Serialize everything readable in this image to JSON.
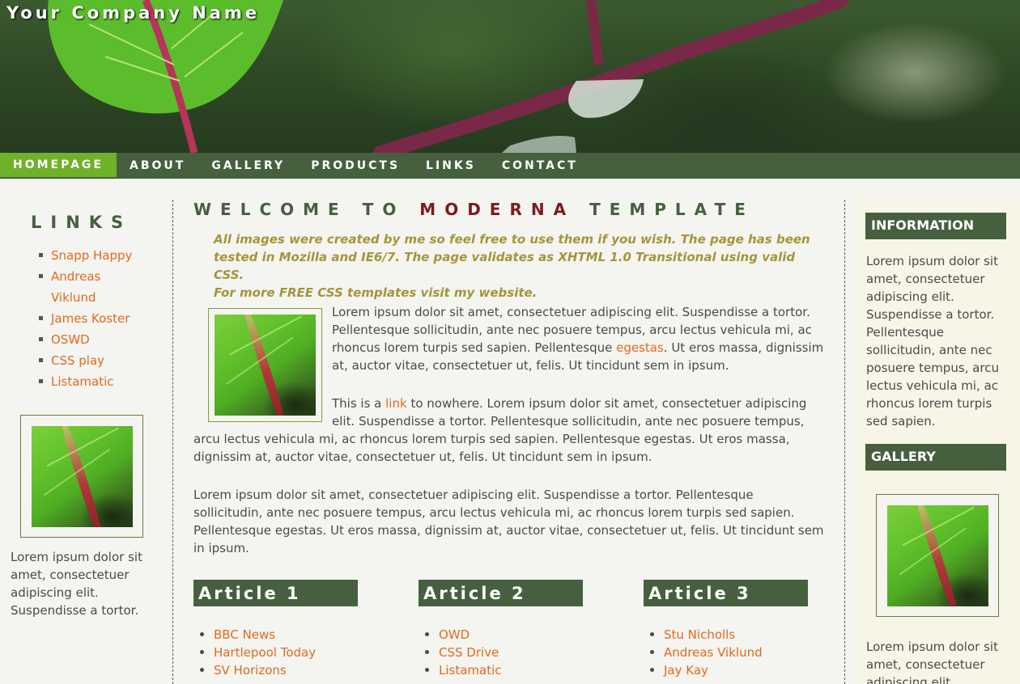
{
  "site": {
    "title": "Your Company Name"
  },
  "nav": [
    {
      "label": "HOMEPAGE",
      "active": true
    },
    {
      "label": "ABOUT"
    },
    {
      "label": "GALLERY"
    },
    {
      "label": "PRODUCTS"
    },
    {
      "label": "LINKS"
    },
    {
      "label": "CONTACT"
    }
  ],
  "left": {
    "links_title": "LINKS",
    "links": [
      "Snapp Happy",
      "Andreas Viklund",
      "James Koster",
      "OSWD",
      "CSS play",
      "Listamatic"
    ],
    "text": "Lorem ipsum dolor sit amet, consectetuer adipiscing elit. Suspendisse a tortor."
  },
  "main": {
    "welcome_pre": "WELCOME TO",
    "welcome_accent": "MODERNA",
    "welcome_post": "TEMPLATE",
    "intro_1": "All images were created by me so feel free to use them if you wish. The page has been tested in Mozilla and IE6/7. The page validates as XHTML 1.0 Transitional using valid CSS.",
    "intro_2": "For more FREE CSS templates visit my website.",
    "p1_a": "Lorem ipsum dolor sit amet, consectetuer adipiscing elit. Suspendisse a tortor. Pellentesque sollicitudin, ante nec posuere tempus, arcu lectus vehicula mi, ac rhoncus lorem turpis sed sapien. Pellentesque ",
    "p1_link": "egestas",
    "p1_b": ". Ut eros massa, dignissim at, auctor vitae, consectetuer ut, felis. Ut tincidunt sem in ipsum.",
    "p2_a": "This is a ",
    "p2_link": "link",
    "p2_b": " to nowhere. Lorem ipsum dolor sit amet, consectetuer adipiscing elit. Suspendisse a tortor. Pellentesque sollicitudin, ante nec posuere tempus, arcu lectus vehicula mi, ac rhoncus lorem turpis sed sapien. Pellentesque egestas. Ut eros massa, dignissim at, auctor vitae, consectetuer ut, felis. Ut tincidunt sem in ipsum.",
    "p3": "Lorem ipsum dolor sit amet, consectetuer adipiscing elit. Suspendisse a tortor. Pellentesque sollicitudin, ante nec posuere tempus, arcu lectus vehicula mi, ac rhoncus lorem turpis sed sapien. Pellentesque egestas. Ut eros massa, dignissim at, auctor vitae, consectetuer ut, felis. Ut tincidunt sem in ipsum.",
    "articles": [
      {
        "title": "Article 1",
        "links": [
          "BBC News",
          "Hartlepool Today",
          "SV Horizons"
        ]
      },
      {
        "title": "Article 2",
        "links": [
          "OWD",
          "CSS Drive",
          "Listamatic"
        ]
      },
      {
        "title": "Article 3",
        "links": [
          "Stu Nicholls",
          "Andreas Viklund",
          "Jay Kay"
        ]
      }
    ]
  },
  "right": {
    "info_title": "INFORMATION",
    "info_text": "Lorem ipsum dolor sit amet, consectetuer adipiscing elit. Suspendisse a tortor. Pellentesque sollicitudin, ante nec posuere tempus, arcu lectus vehicula mi, ac rhoncus lorem turpis sed sapien.",
    "gallery_title": "GALLERY",
    "gallery_text": "Lorem ipsum dolor sit amet, consectetuer adipiscing elit."
  },
  "colors": {
    "nav_bg": "#46603f",
    "nav_active": "#6fb22a",
    "link": "#e26a1b",
    "intro": "#a5953a",
    "accent": "#7a1c1c"
  }
}
